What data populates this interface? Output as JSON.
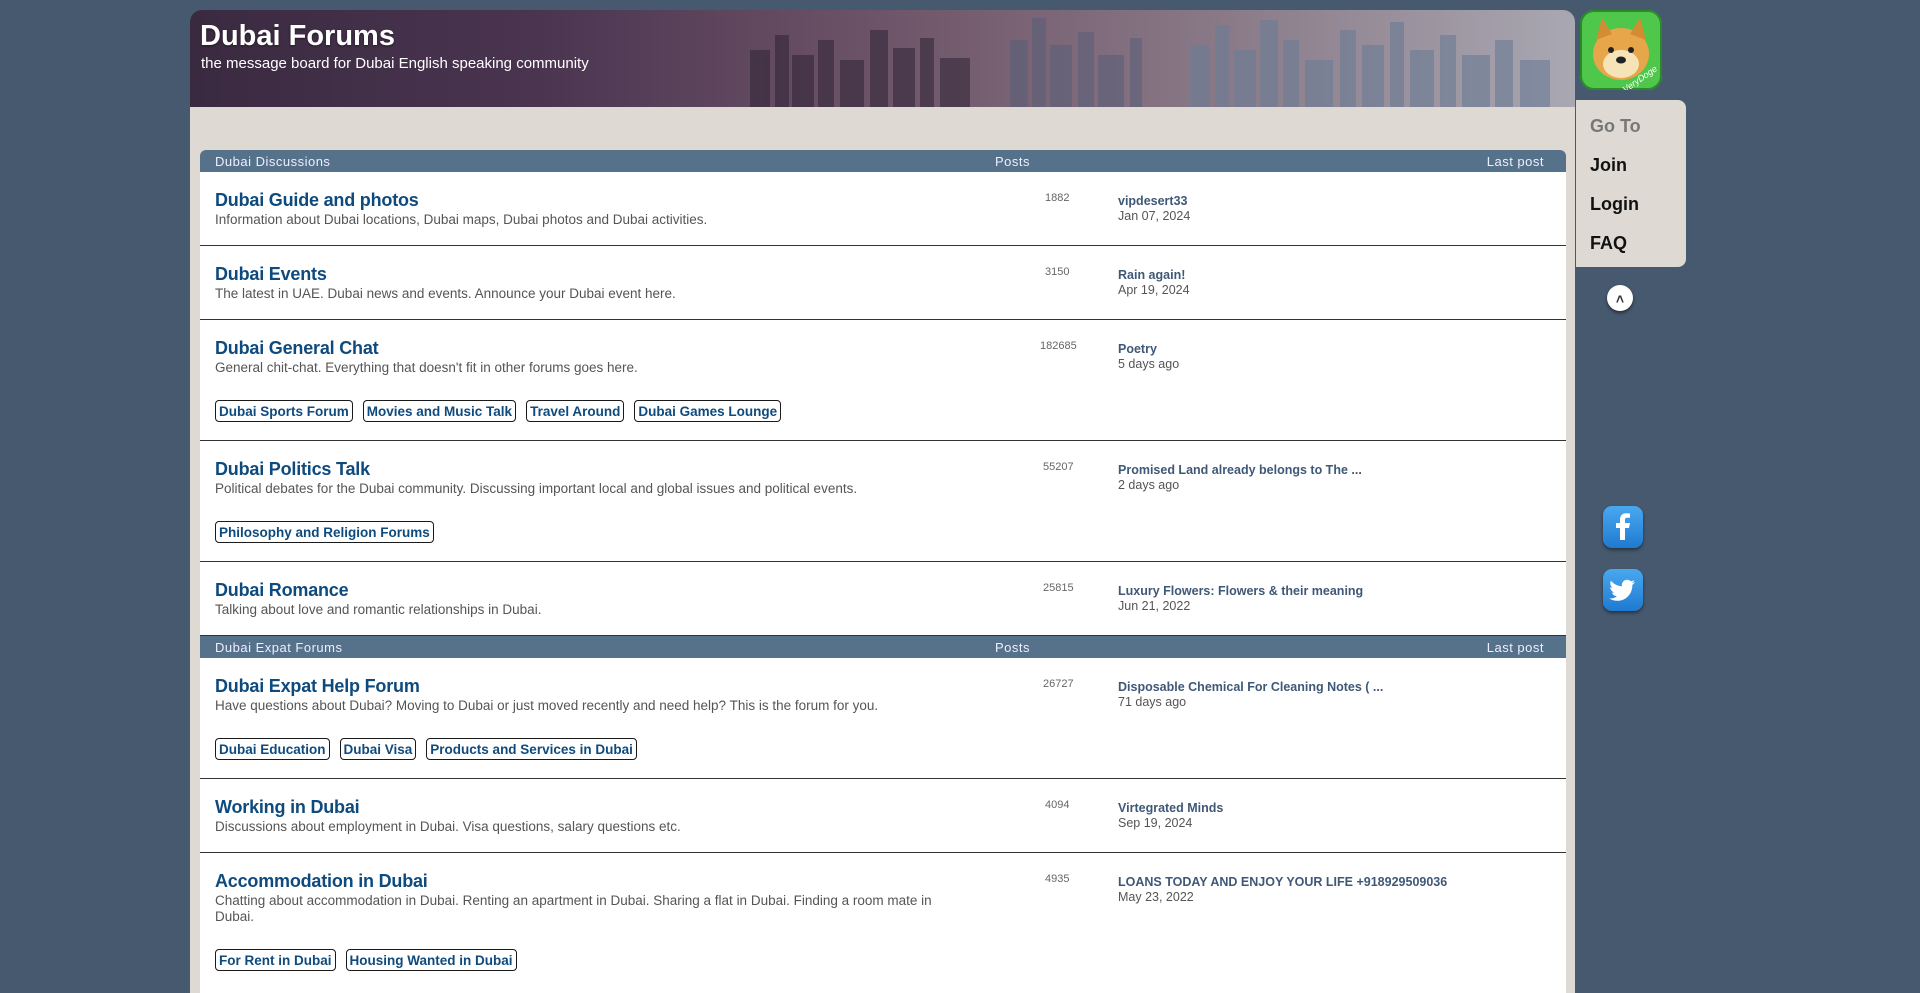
{
  "site": {
    "title": "Dubai Forums",
    "tagline": "the message board for Dubai English speaking community"
  },
  "nav": {
    "goto_heading": "Go To",
    "items": [
      {
        "label": "Join"
      },
      {
        "label": "Login"
      },
      {
        "label": "FAQ"
      }
    ],
    "scroll_up_glyph": "˄",
    "avatar_label": "VeryDoge"
  },
  "icons": {
    "facebook": "facebook-icon",
    "twitter": "twitter-icon",
    "scroll": "chevron-up-icon"
  },
  "colors": {
    "background": "#46596e",
    "category_header": "#55728a",
    "forum_link": "#0e4a7e",
    "panel": "#dedad3"
  },
  "categories": [
    {
      "name": "Dubai Discussions",
      "col_posts": "Posts",
      "col_last": "Last post",
      "forums": [
        {
          "title": "Dubai Guide and photos",
          "description": "Information about Dubai locations, Dubai maps, Dubai photos and Dubai activities.",
          "posts": "1882",
          "last_post_title": "vipdesert33",
          "last_post_date": "Jan 07, 2024",
          "subforums": []
        },
        {
          "title": "Dubai Events",
          "description": "The latest in UAE. Dubai news and events. Announce your Dubai event here.",
          "posts": "3150",
          "last_post_title": "Rain again!",
          "last_post_date": "Apr 19, 2024",
          "subforums": []
        },
        {
          "title": "Dubai General Chat",
          "description": "General chit-chat. Everything that doesn't fit in other forums goes here.",
          "posts": "182685",
          "last_post_title": "Poetry",
          "last_post_date": "5 days ago",
          "subforums": [
            "Dubai Sports Forum",
            "Movies and Music Talk",
            "Travel Around",
            "Dubai Games Lounge"
          ]
        },
        {
          "title": "Dubai Politics Talk",
          "description": "Political debates for the Dubai community. Discussing important local and global issues and political events.",
          "posts": "55207",
          "last_post_title": "Promised Land already belongs to The ...",
          "last_post_date": "2 days ago",
          "subforums": [
            "Philosophy and Religion Forums"
          ]
        },
        {
          "title": "Dubai Romance",
          "description": "Talking about love and romantic relationships in Dubai.",
          "posts": "25815",
          "last_post_title": "Luxury Flowers: Flowers & their meaning",
          "last_post_date": "Jun 21, 2022",
          "subforums": []
        }
      ]
    },
    {
      "name": "Dubai Expat Forums",
      "col_posts": "Posts",
      "col_last": "Last post",
      "forums": [
        {
          "title": "Dubai Expat Help Forum",
          "description": "Have questions about Dubai? Moving to Dubai or just moved recently and need help? This is the forum for you.",
          "posts": "26727",
          "last_post_title": "Disposable Chemical For Cleaning Notes ( ...",
          "last_post_date": "71 days ago",
          "subforums": [
            "Dubai Education",
            "Dubai Visa",
            "Products and Services in Dubai"
          ]
        },
        {
          "title": "Working in Dubai",
          "description": "Discussions about employment in Dubai. Visa questions, salary questions etc.",
          "posts": "4094",
          "last_post_title": "Virtegrated Minds",
          "last_post_date": "Sep 19, 2024",
          "subforums": []
        },
        {
          "title": "Accommodation in Dubai",
          "description": "Chatting about accommodation in Dubai. Renting an apartment in Dubai. Sharing a flat in Dubai. Finding a room mate in Dubai.",
          "posts": "4935",
          "last_post_title": "LOANS TODAY AND ENJOY YOUR LIFE +918929509036",
          "last_post_date": "May 23, 2022",
          "subforums": [
            "For Rent in Dubai",
            "Housing Wanted in Dubai"
          ]
        }
      ]
    }
  ]
}
